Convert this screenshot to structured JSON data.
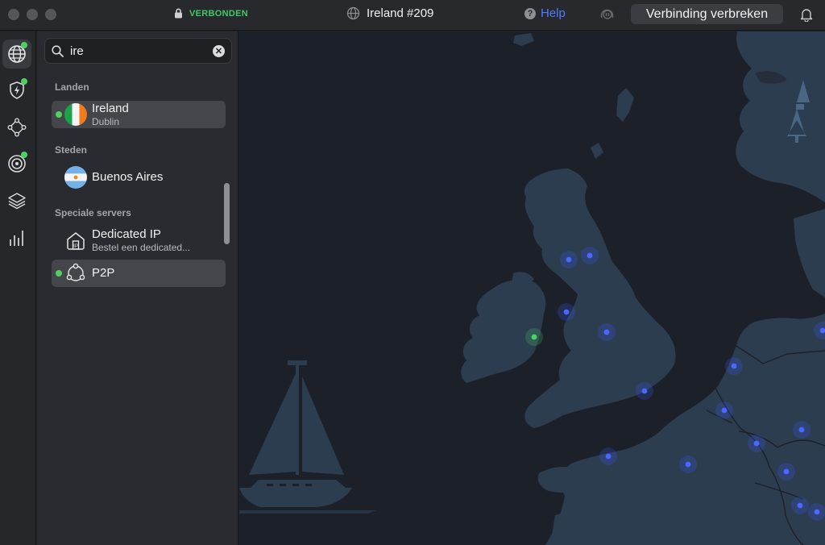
{
  "titlebar": {
    "status": "VERBONDEN",
    "server": "Ireland #209",
    "help": "Help",
    "disconnect": "Verbinding verbreken"
  },
  "search": {
    "value": "ire"
  },
  "sections": {
    "countries": "Landen",
    "cities": "Steden",
    "special": "Speciale servers"
  },
  "results": {
    "ireland": {
      "title": "Ireland",
      "subtitle": "Dublin"
    },
    "buenos_aires": {
      "title": "Buenos Aires"
    },
    "dedicated_ip": {
      "title": "Dedicated IP",
      "subtitle": "Bestel een dedicated..."
    },
    "p2p": {
      "title": "P2P"
    }
  },
  "rail": {
    "icons": [
      "globe-icon",
      "shield-bolt-icon",
      "meshnet-icon",
      "target-icon",
      "layers-icon",
      "stats-icon"
    ]
  },
  "colors": {
    "connected": "#4fd162",
    "accent": "#4e7dff",
    "server_marker": "#3d5bff",
    "map_land": "#2c3d50",
    "map_sea": "#1c2029"
  }
}
